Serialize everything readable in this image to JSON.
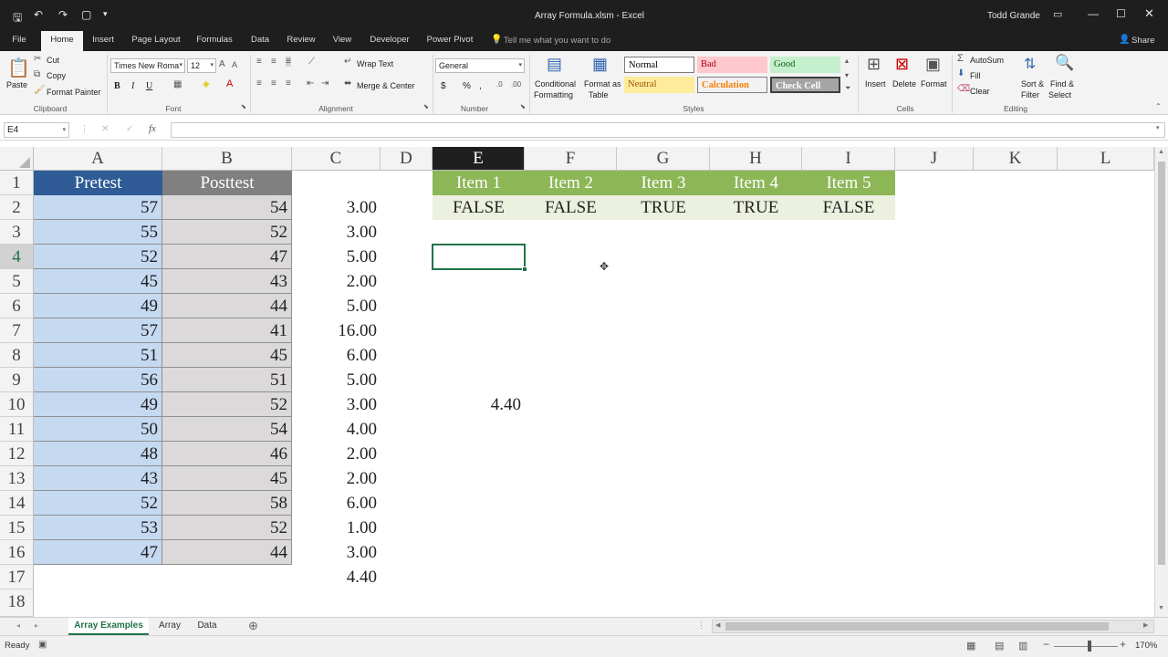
{
  "titlebar": {
    "title": "Array Formula.xlsm - Excel",
    "user": "Todd Grande",
    "share": "Share",
    "tell_me": "Tell me what you want to do"
  },
  "ribbon_tabs": [
    "File",
    "Home",
    "Insert",
    "Page Layout",
    "Formulas",
    "Data",
    "Review",
    "View",
    "Developer",
    "Power Pivot"
  ],
  "clipboard": {
    "paste": "Paste",
    "cut": "Cut",
    "copy": "Copy",
    "format_painter": "Format Painter",
    "label": "Clipboard"
  },
  "font": {
    "name": "Times New Roma",
    "size": "12",
    "bold": "B",
    "italic": "I",
    "underline": "U",
    "label": "Font"
  },
  "alignment": {
    "wrap": "Wrap Text",
    "merge": "Merge & Center",
    "label": "Alignment"
  },
  "number": {
    "format": "General",
    "currency": "$",
    "percent": "%",
    "comma": ",",
    "label": "Number"
  },
  "styles": {
    "conditional": "Conditional",
    "formatting": "Formatting",
    "format_as": "Format as",
    "table": "Table",
    "normal": "Normal",
    "bad": "Bad",
    "good": "Good",
    "neutral": "Neutral",
    "calculation": "Calculation",
    "check_cell": "Check Cell",
    "label": "Styles"
  },
  "cells_grp": {
    "insert": "Insert",
    "delete": "Delete",
    "format": "Format",
    "label": "Cells"
  },
  "editing": {
    "autosum": "AutoSum",
    "fill": "Fill",
    "clear": "Clear",
    "sort": "Sort &",
    "filter": "Filter",
    "find": "Find &",
    "select": "Select",
    "label": "Editing"
  },
  "formula_bar": {
    "name_box": "E4",
    "fx": "fx",
    "cancel": "✕",
    "enter": "✓"
  },
  "columns": [
    "A",
    "B",
    "C",
    "D",
    "E",
    "F",
    "G",
    "H",
    "I",
    "J",
    "K",
    "L"
  ],
  "rows": [
    "1",
    "2",
    "3",
    "4",
    "5",
    "6",
    "7",
    "8",
    "9",
    "10",
    "11",
    "12",
    "13",
    "14",
    "15",
    "16",
    "17",
    "18"
  ],
  "headers": {
    "a": "Pretest",
    "b": "Posttest"
  },
  "pretest": [
    "57",
    "55",
    "52",
    "45",
    "49",
    "57",
    "51",
    "56",
    "49",
    "50",
    "48",
    "43",
    "52",
    "53",
    "47"
  ],
  "posttest": [
    "54",
    "52",
    "47",
    "43",
    "44",
    "41",
    "45",
    "51",
    "52",
    "54",
    "46",
    "45",
    "58",
    "52",
    "44"
  ],
  "col_c": [
    "3.00",
    "3.00",
    "5.00",
    "2.00",
    "5.00",
    "16.00",
    "6.00",
    "5.00",
    "3.00",
    "4.00",
    "2.00",
    "2.00",
    "6.00",
    "1.00",
    "3.00",
    "4.40"
  ],
  "items": {
    "headers": [
      "Item 1",
      "Item 2",
      "Item 3",
      "Item 4",
      "Item 5"
    ],
    "values": [
      "FALSE",
      "FALSE",
      "TRUE",
      "TRUE",
      "FALSE"
    ]
  },
  "e10_value": "4.40",
  "sheets": [
    "Array Examples",
    "Array",
    "Data"
  ],
  "status": {
    "ready": "Ready",
    "zoom": "170%"
  },
  "colors": {
    "excel_green": "#217346",
    "pretest_header": "#2f5b97",
    "posttest_header": "#808080",
    "item_header": "#8db657"
  }
}
